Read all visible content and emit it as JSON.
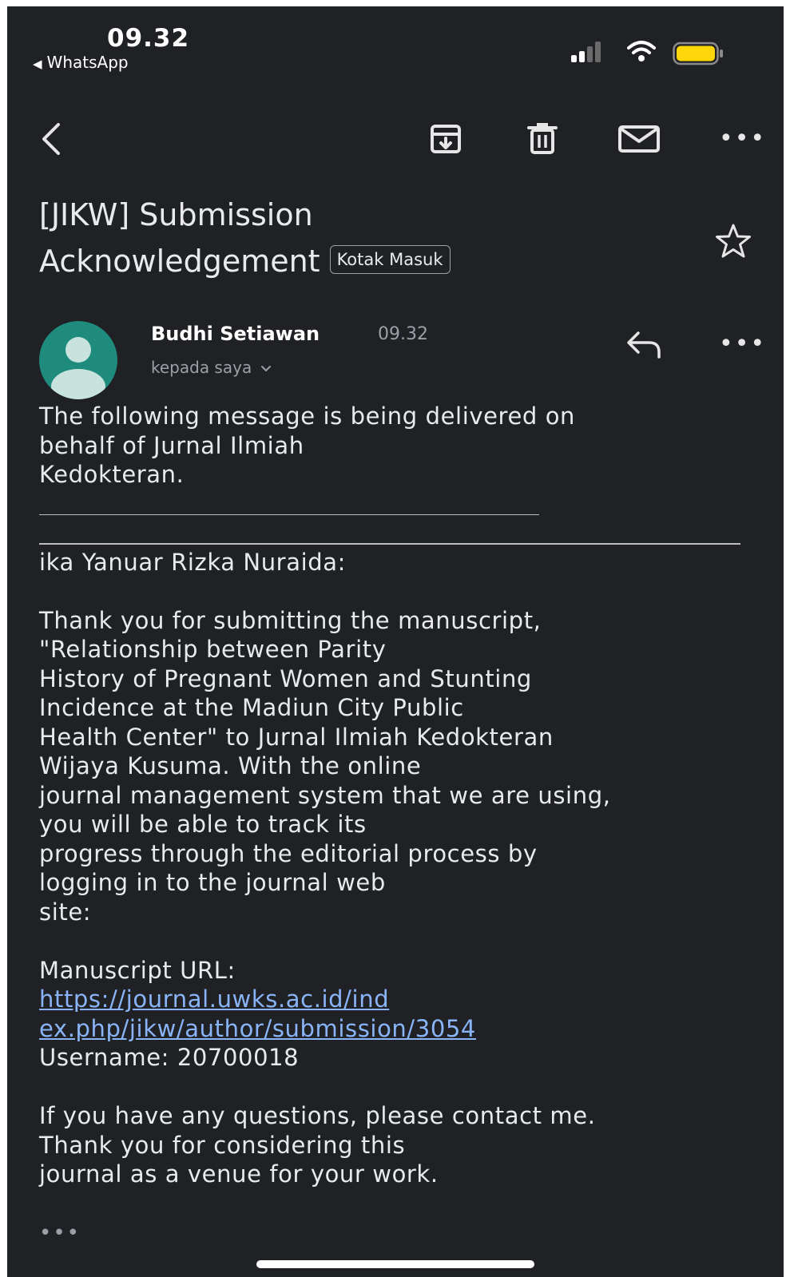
{
  "status_bar": {
    "time": "09.32",
    "back_app": "WhatsApp"
  },
  "subject": {
    "line1": "[JIKW] Submission",
    "line2": "Acknowledgement",
    "label": "Kotak Masuk"
  },
  "sender": {
    "name": "Budhi Setiawan",
    "time": "09.32",
    "recipient": "kepada saya"
  },
  "body": {
    "intro": [
      "The following message is being delivered on",
      "behalf of Jurnal Ilmiah",
      "Kedokteran."
    ],
    "short_rule": "________________________________________",
    "long_rule": "________________________________________________________",
    "greeting": "ika Yanuar Rizka Nuraida:",
    "paragraph": [
      "Thank you for submitting the manuscript,",
      "\"Relationship between Parity",
      "History of Pregnant Women and Stunting",
      "Incidence at the Madiun City Public",
      "Health Center\" to Jurnal Ilmiah Kedokteran",
      "Wijaya Kusuma. With the online",
      "journal management system that we are using,",
      "you will be able to track its",
      "progress through the editorial process by",
      "logging in to the journal web",
      "site:"
    ],
    "manuscript_url_label": "Manuscript URL:",
    "url_line1": "https://journal.uwks.ac.id/ind",
    "url_line2": "ex.php/jikw/author/submission/3054",
    "username": "Username: 20700018",
    "closing": [
      "If you have any questions, please contact me.",
      "Thank you for considering this",
      "journal as a venue for your work."
    ],
    "more": "•••"
  },
  "toolbar": {
    "more": "•••"
  },
  "colors": {
    "background": "#202124",
    "text": "#e8eaed",
    "secondary_text": "#9aa0a6",
    "link": "#8ab4f8",
    "avatar": "#1e8b7c",
    "battery": "#ffd60a"
  },
  "icons": [
    "back-arrow-icon",
    "archive-icon",
    "trash-icon",
    "mail-icon",
    "more-icon",
    "star-icon",
    "reply-icon",
    "chevron-down-icon",
    "signal-icon",
    "wifi-icon",
    "battery-icon"
  ]
}
